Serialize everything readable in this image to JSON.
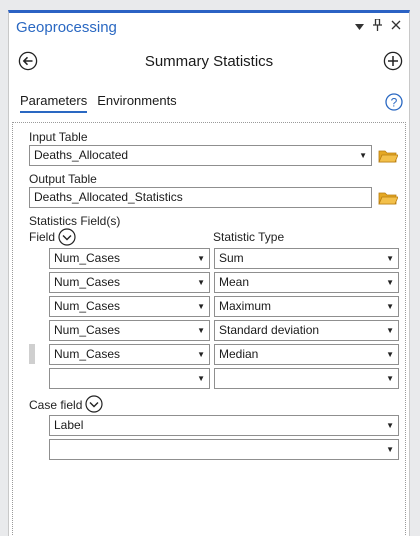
{
  "pane": {
    "title": "Geoprocessing"
  },
  "window_buttons": {
    "dropdown": "▾",
    "pin": "⊥",
    "close": "✕"
  },
  "tool": {
    "title": "Summary Statistics"
  },
  "tabs": [
    {
      "label": "Parameters",
      "active": true
    },
    {
      "label": "Environments",
      "active": false
    }
  ],
  "form": {
    "input_table": {
      "label": "Input Table",
      "value": "Deaths_Allocated"
    },
    "output_table": {
      "label": "Output Table",
      "value": "Deaths_Allocated_Statistics"
    },
    "statistics_fields": {
      "label": "Statistics Field(s)",
      "field_header": "Field",
      "stat_header": "Statistic Type",
      "rows": [
        {
          "field": "Num_Cases",
          "stat": "Sum"
        },
        {
          "field": "Num_Cases",
          "stat": "Mean"
        },
        {
          "field": "Num_Cases",
          "stat": "Maximum"
        },
        {
          "field": "Num_Cases",
          "stat": "Standard deviation"
        },
        {
          "field": "Num_Cases",
          "stat": "Median"
        },
        {
          "field": "",
          "stat": ""
        }
      ]
    },
    "case_field": {
      "label": "Case field",
      "rows": [
        "Label",
        ""
      ]
    }
  },
  "colors": {
    "accent": "#2a68c2",
    "folder": "#e5a823"
  }
}
